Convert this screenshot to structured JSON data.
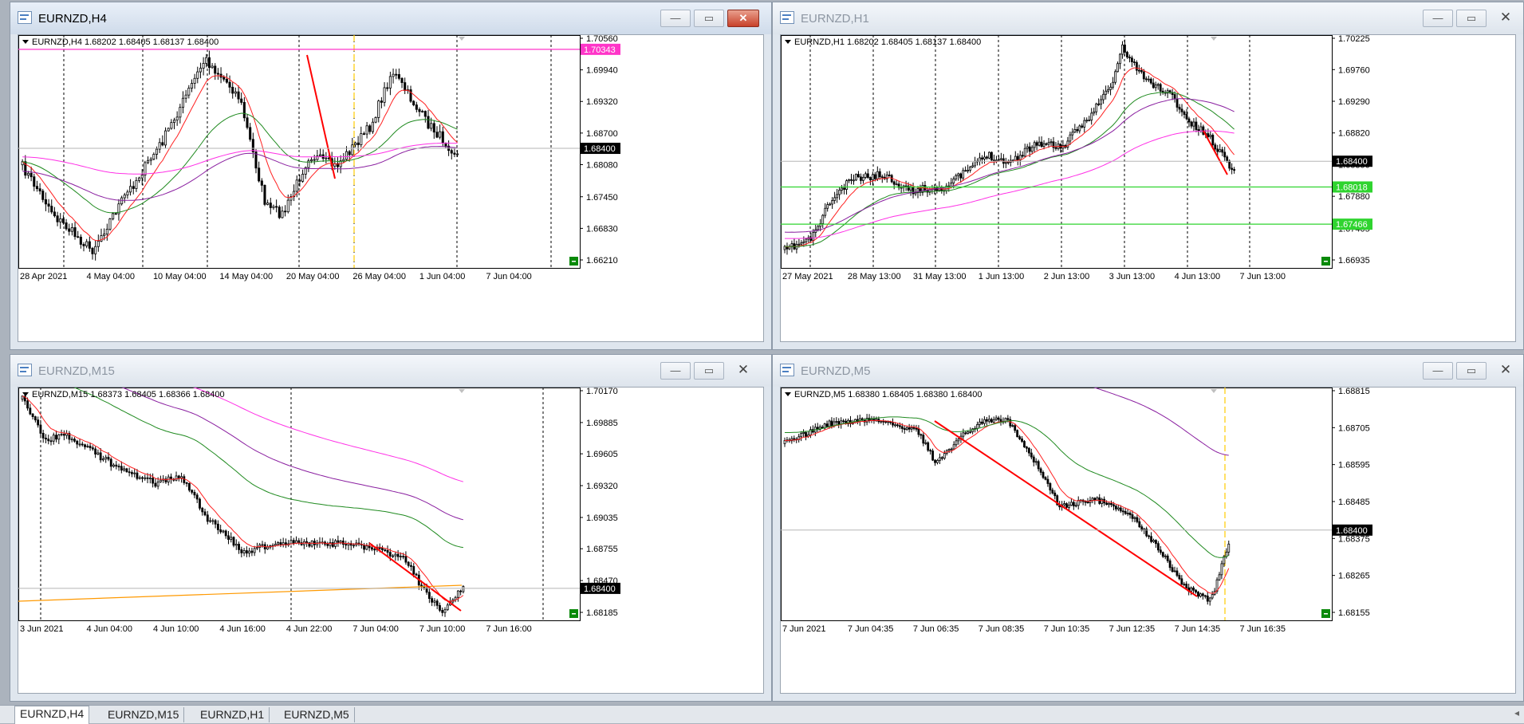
{
  "windows": [
    {
      "title": "EURNZD,H4",
      "active": true,
      "header_text": "EURNZD,H4  1.68202 1.68405 1.68137 1.68400",
      "price_labels": [
        "1.70560",
        "1.69940",
        "1.69320",
        "1.68700",
        "1.68080",
        "1.67450",
        "1.66830",
        "1.66210"
      ],
      "current_price": "1.68400",
      "hlines": [
        {
          "price": "1.70343",
          "color": "#ff35c8"
        }
      ],
      "time_labels": [
        "28 Apr 2021",
        "4 May 04:00",
        "10 May 04:00",
        "14 May 04:00",
        "20 May 04:00",
        "26 May 04:00",
        "1 Jun 04:00",
        "7 Jun 04:00"
      ]
    },
    {
      "title": "EURNZD,H1",
      "active": false,
      "header_text": "EURNZD,H1  1.68202 1.68405 1.68137 1.68400",
      "price_labels": [
        "1.70225",
        "1.69760",
        "1.69290",
        "1.68820",
        "1.68350",
        "1.67880",
        "1.67405",
        "1.66935"
      ],
      "current_price": "1.68400",
      "hlines": [
        {
          "price": "1.68018",
          "color": "#2fd42f"
        },
        {
          "price": "1.67466",
          "color": "#2fd42f"
        }
      ],
      "time_labels": [
        "27 May 2021",
        "28 May 13:00",
        "31 May 13:00",
        "1 Jun 13:00",
        "2 Jun 13:00",
        "3 Jun 13:00",
        "4 Jun 13:00",
        "7 Jun 13:00"
      ]
    },
    {
      "title": "EURNZD,M15",
      "active": false,
      "header_text": "EURNZD,M15  1.68373 1.68405 1.68366 1.68400",
      "price_labels": [
        "1.70170",
        "1.69885",
        "1.69605",
        "1.69320",
        "1.69035",
        "1.68755",
        "1.68470",
        "1.68185"
      ],
      "current_price": "1.68400",
      "hlines": [],
      "time_labels": [
        "3 Jun 2021",
        "4 Jun 04:00",
        "4 Jun 10:00",
        "4 Jun 16:00",
        "4 Jun 22:00",
        "7 Jun 04:00",
        "7 Jun 10:00",
        "7 Jun 16:00"
      ]
    },
    {
      "title": "EURNZD,M5",
      "active": false,
      "header_text": "EURNZD,M5  1.68380 1.68405 1.68380 1.68400",
      "price_labels": [
        "1.68815",
        "1.68705",
        "1.68595",
        "1.68485",
        "1.68375",
        "1.68265",
        "1.68155"
      ],
      "current_price": "1.68400",
      "hlines": [],
      "time_labels": [
        "7 Jun 2021",
        "7 Jun 04:35",
        "7 Jun 06:35",
        "7 Jun 08:35",
        "7 Jun 10:35",
        "7 Jun 12:35",
        "7 Jun 14:35",
        "7 Jun 16:35"
      ]
    }
  ],
  "window_buttons": {
    "minimize": "—",
    "maximize": "▭",
    "close": "✕"
  },
  "tabs": [
    "EURNZD,H4",
    "EURNZD,M15",
    "EURNZD,H1",
    "EURNZD,M5"
  ],
  "tab_scroll_icon": "◂",
  "colors": {
    "bull_candle": "#ffffff",
    "bear_candle": "#000000",
    "ma_fast": "#ff2020",
    "ma_mid": "#1f8a1f",
    "ma_slow": "#8a1fa0",
    "ma_slowest": "#ff30e6",
    "ma_orange": "#ff9900",
    "trendline": "#ff0000",
    "grid_line": "#000000",
    "current_price_bg": "#000000",
    "vline_yellow": "#ffcc00"
  }
}
